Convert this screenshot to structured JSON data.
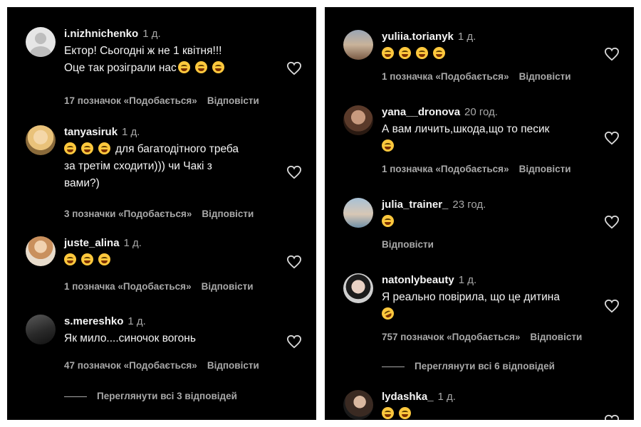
{
  "left": {
    "top_fade_text": "",
    "comments": [
      {
        "user": "i.nizhnichenko",
        "time": "1 д.",
        "lines": [
          "Ектор! Сьогодні ж не 1 квітня!!!",
          "Оце так розіграли нас"
        ],
        "likes": "17 позначок «Подобається»",
        "reply": "Відповісти"
      },
      {
        "user": "tanyasiruk",
        "time": "1 д.",
        "lines": [
          "для багатодітного треба",
          "за третім сходити))) чи Чакі з",
          "вами?)"
        ],
        "likes": "3 позначки «Подобається»",
        "reply": "Відповісти"
      },
      {
        "user": "juste_alina",
        "time": "1 д.",
        "lines": [],
        "likes": "1 позначка «Подобається»",
        "reply": "Відповісти"
      },
      {
        "user": "s.mereshko",
        "time": "1 д.",
        "lines": [
          "Як мило....синочок вогонь"
        ],
        "likes": "47 позначок «Подобається»",
        "reply": "Відповісти"
      }
    ],
    "view_replies": "Переглянути всі 3 відповідей"
  },
  "right": {
    "comments": [
      {
        "user": "yuliia.torianyk",
        "time": "1 д.",
        "lines": [],
        "likes": "1 позначка «Подобається»",
        "reply": "Відповісти"
      },
      {
        "user": "yana__dronova",
        "time": "20 год.",
        "lines": [
          "А вам личить,шкода,що то песик"
        ],
        "likes": "1 позначка «Подобається»",
        "reply": "Відповісти"
      },
      {
        "user": "julia_trainer_",
        "time": "23 год.",
        "lines": [],
        "reply": "Відповісти"
      },
      {
        "user": "natonlybeauty",
        "time": "1 д.",
        "lines": [
          "Я реально повірила, що це дитина"
        ],
        "likes": "757 позначок «Подобається»",
        "reply": "Відповісти"
      },
      {
        "user": "lydashka_",
        "time": "1 д.",
        "lines": []
      }
    ],
    "view_replies": "Переглянути всі 6 відповідей"
  },
  "colors": {
    "background": "#000000",
    "text": "#f5f5f5",
    "muted": "#a8a8a8",
    "separator": "#ffffff"
  },
  "icons": {
    "like": "heart-outline-icon",
    "emoji_grin": "grinning-squinting-face",
    "emoji_rofl": "rolling-on-floor-laughing"
  }
}
